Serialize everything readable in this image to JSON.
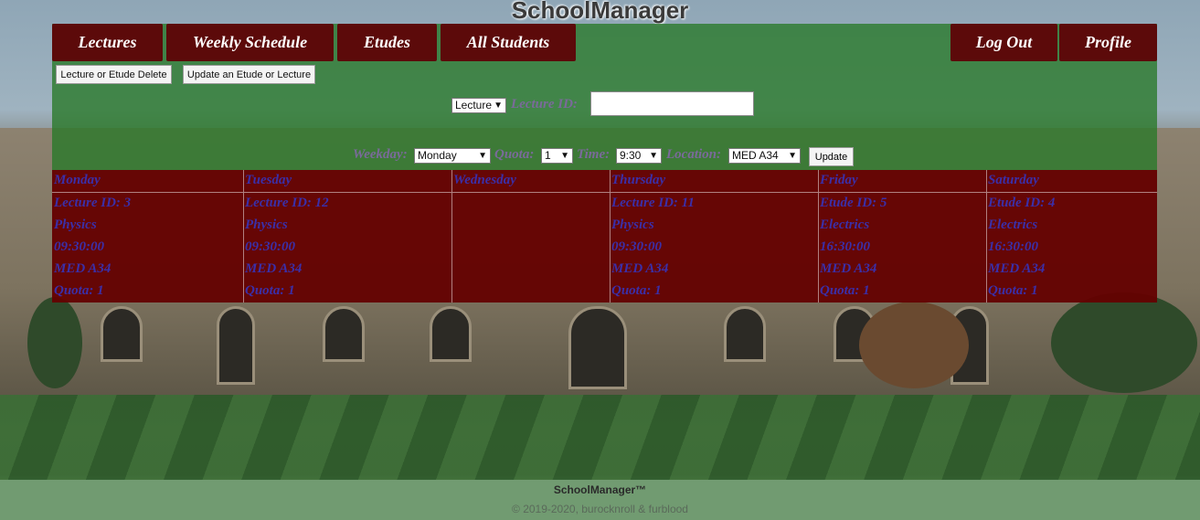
{
  "app": {
    "title": "SchoolManager"
  },
  "nav": {
    "lectures": "Lectures",
    "weekly_schedule": "Weekly Schedule",
    "etudes": "Etudes",
    "all_students": "All Students",
    "log_out": "Log Out",
    "profile": "Profile"
  },
  "actions": {
    "delete_label": "Lecture or Etude Delete",
    "update_label": "Update an Etude or Lecture"
  },
  "form": {
    "type_select": "Lecture",
    "lecture_id_label": "Lecture ID:",
    "lecture_id_value": "",
    "weekday_label": "Weekday:",
    "weekday_value": "Monday",
    "quota_label": "Quota:",
    "quota_value": "1",
    "time_label": "Time:",
    "time_value": "9:30",
    "location_label": "Location:",
    "location_value": "MED A34",
    "update_button": "Update"
  },
  "schedule": {
    "days": [
      {
        "day": "Monday",
        "id": "Lecture ID: 3",
        "subject": "Physics",
        "time": "09:30:00",
        "location": "MED A34",
        "quota": "Quota: 1"
      },
      {
        "day": "Tuesday",
        "id": "Lecture ID: 12",
        "subject": "Physics",
        "time": "09:30:00",
        "location": "MED A34",
        "quota": "Quota: 1"
      },
      {
        "day": "Wednesday",
        "id": "",
        "subject": "",
        "time": "",
        "location": "",
        "quota": ""
      },
      {
        "day": "Thursday",
        "id": "Lecture ID: 11",
        "subject": "Physics",
        "time": "09:30:00",
        "location": "MED A34",
        "quota": "Quota: 1"
      },
      {
        "day": "Friday",
        "id": "Etude ID: 5",
        "subject": "Electrics",
        "time": "16:30:00",
        "location": "MED A34",
        "quota": "Quota: 1"
      },
      {
        "day": "Saturday",
        "id": "Etude ID: 4",
        "subject": "Electrics",
        "time": "16:30:00",
        "location": "MED A34",
        "quota": "Quota: 1"
      }
    ]
  },
  "footer": {
    "brand": "SchoolManager™",
    "copyright": "© 2019-2020, burocknroll & furblood"
  },
  "colors": {
    "nav_button": "#5c0a0a",
    "panel": "#2e7d2e",
    "schedule_bg": "#640000",
    "schedule_text": "#3b2fa8"
  }
}
